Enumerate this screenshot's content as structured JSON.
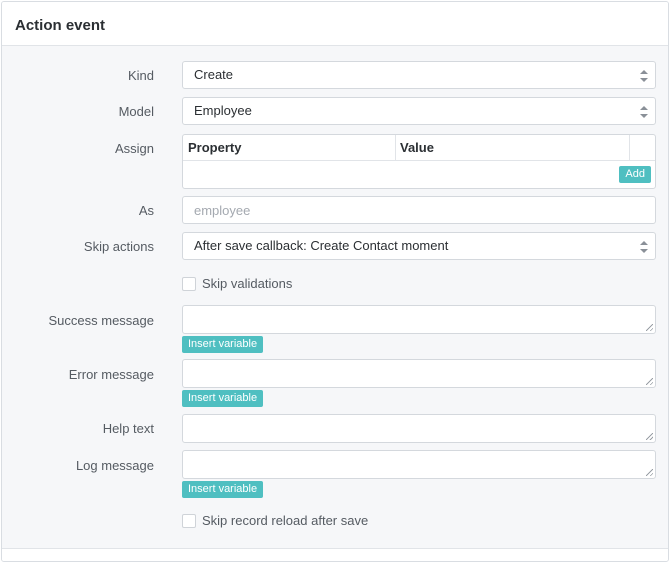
{
  "panel": {
    "title": "Action event"
  },
  "fields": {
    "kind": {
      "label": "Kind",
      "value": "Create"
    },
    "model": {
      "label": "Model",
      "value": "Employee"
    },
    "assign": {
      "label": "Assign",
      "columns": [
        "Property",
        "Value"
      ],
      "add_label": "Add"
    },
    "as": {
      "label": "As",
      "value": "",
      "placeholder": "employee"
    },
    "skip_actions": {
      "label": "Skip actions",
      "value": "After save callback: Create Contact moment"
    },
    "skip_validations": {
      "label": "Skip validations",
      "checked": false
    },
    "success_message": {
      "label": "Success message",
      "value": "",
      "insert_label": "Insert variable"
    },
    "error_message": {
      "label": "Error message",
      "value": "",
      "insert_label": "Insert variable"
    },
    "help_text": {
      "label": "Help text",
      "value": ""
    },
    "log_message": {
      "label": "Log message",
      "value": "",
      "insert_label": "Insert variable"
    },
    "skip_record_reload": {
      "label": "Skip record reload after save",
      "checked": false
    }
  },
  "icons": {
    "select": "up-down-arrows-icon",
    "textarea": "resize-grip-icon"
  },
  "colors": {
    "accent": "#4fbfc1",
    "panel_bg": "#f6f7f9",
    "border": "#d4d8dd"
  }
}
